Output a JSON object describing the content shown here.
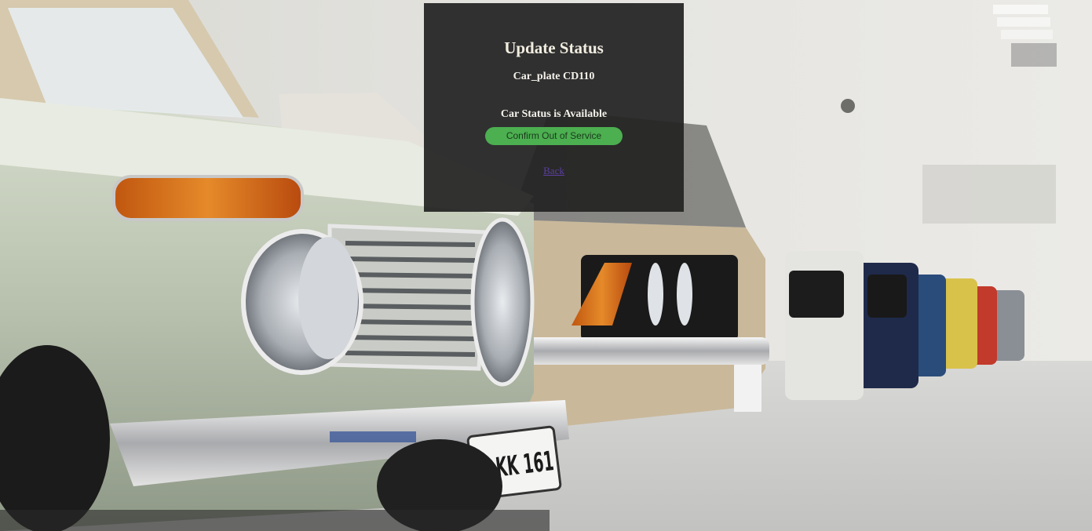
{
  "panel": {
    "title": "Update Status",
    "plate_text": "Car_plate CD110",
    "status_text": "Car Status is Available",
    "confirm_label": "Confirm Out of Service",
    "back_label": "Back"
  },
  "colors": {
    "panel_background": "#222222",
    "confirm_button": "#4caf50",
    "link": "#5a3fa0"
  },
  "background": {
    "license_plate_text": "M-KK 161"
  }
}
